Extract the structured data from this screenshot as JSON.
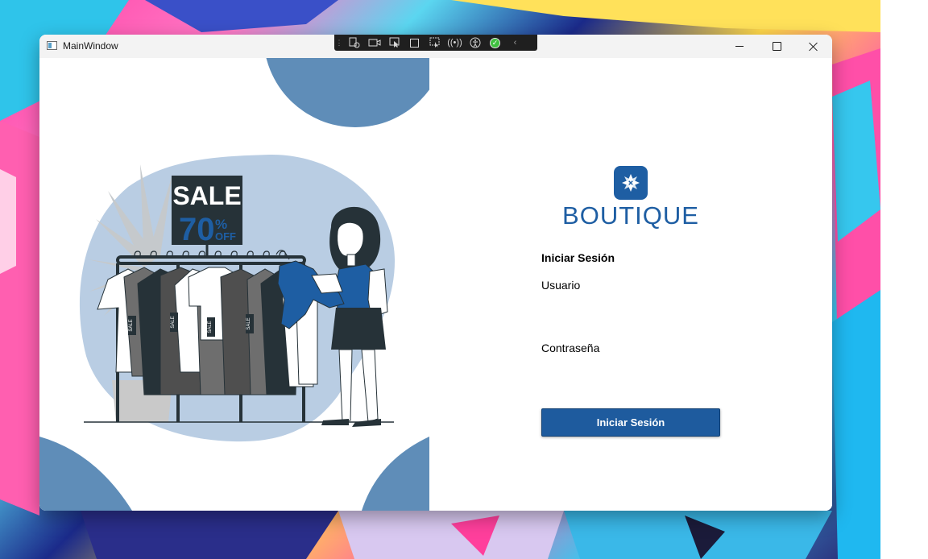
{
  "window": {
    "title": "MainWindow",
    "controls": [
      "minimize-icon",
      "maximize-icon",
      "close-icon"
    ]
  },
  "debug_toolbar": {
    "icons": [
      "grip-icon",
      "live-visual-tree-icon",
      "camera-icon",
      "select-element-icon",
      "display-layout-adorners-icon",
      "track-focused-element-icon",
      "hot-reload-icon",
      "accessibility-icon",
      "checkmark-icon",
      "collapse-chevron-icon"
    ]
  },
  "illustration": {
    "sign_line1": "SALE",
    "sign_percent": "70",
    "sign_percent_symbol": "%",
    "sign_off": "OFF",
    "tag_text": "SALE",
    "colors": {
      "accent": "#1e5ea3",
      "light_blue": "#b9cde3",
      "dark": "#263238"
    }
  },
  "login": {
    "brand": "BOUTIQUE",
    "heading": "Iniciar Sesión",
    "user_label": "Usuario",
    "user_value": "",
    "password_label": "Contraseña",
    "password_value": "",
    "submit_label": "Iniciar Sesión"
  },
  "colors": {
    "brand_blue": "#1e5ea3",
    "button_blue": "#1e5b9e",
    "decor_blue": "#5f8db8"
  }
}
